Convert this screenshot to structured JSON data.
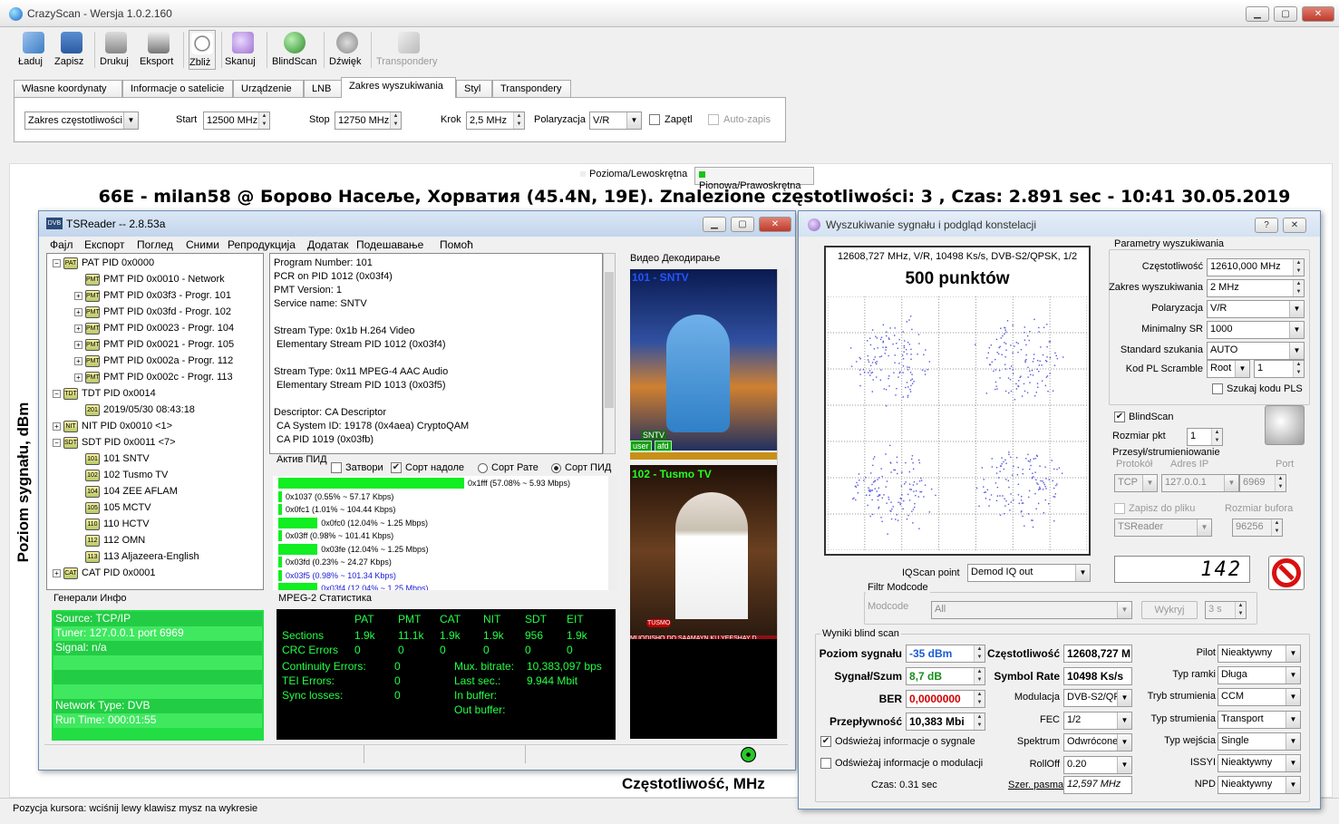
{
  "app": {
    "title": "CrazyScan - Wersja 1.0.2.160"
  },
  "toolbar": [
    {
      "label": "Ładuj",
      "icon": "folder-open-icon"
    },
    {
      "label": "Zapisz",
      "icon": "save-icon"
    },
    {
      "label": "Drukuj",
      "icon": "printer-icon"
    },
    {
      "label": "Eksport",
      "icon": "export-icon"
    },
    {
      "label": "Zbliż",
      "icon": "zoom-icon"
    },
    {
      "label": "Skanuj",
      "icon": "magnifier-icon"
    },
    {
      "label": "BlindScan",
      "icon": "globe-icon"
    },
    {
      "label": "Dźwięk",
      "icon": "speaker-icon"
    },
    {
      "label": "Transpondery",
      "icon": "transponders-icon"
    }
  ],
  "tabs": [
    "Własne koordynaty",
    "Informacje o satelicie",
    "Urządzenie",
    "LNB",
    "Zakres wyszukiwania",
    "Styl",
    "Transpondery"
  ],
  "range": {
    "mode": "Zakres częstotliwości",
    "start_label": "Start",
    "start": "12500 MHz",
    "stop_label": "Stop",
    "stop": "12750 MHz",
    "step_label": "Krok",
    "step": "2,5 MHz",
    "pol_label": "Polaryzacja",
    "pol": "V/R",
    "loop": "Zapętl",
    "autosave": "Auto-zapis"
  },
  "chart": {
    "legend_h": "Pozioma/Lewoskrętna",
    "legend_v": "Pionowa/Prawoskrętna",
    "headline": "66E - milan58 @ Борово Насеље, Хорватия (45.4N, 19E). Znalezione częstotliwości: 3 , Czas: 2.891 sec - 10:41 30.05.2019",
    "ylabel": "Poziom sygnału, dBm",
    "xlabel": "Częstotliwość, MHz"
  },
  "status": "Pozycja kursora: wciśnij lewy klawisz mysz na wykresie",
  "ts": {
    "title": "TSReader -- 2.8.53a",
    "menu": [
      "Фајл",
      "Експорт",
      "Поглед",
      "Сними",
      "Репродукција",
      "Додатак",
      "Подешавање",
      "Помоћ"
    ],
    "tree": [
      {
        "t": "PAT PID 0x0000",
        "lvl": 0,
        "exp": "−"
      },
      {
        "t": "PMT PID 0x0010 - Network",
        "lvl": 1,
        "exp": ""
      },
      {
        "t": "PMT PID 0x03f3 - Progr. 101",
        "lvl": 1,
        "exp": "+"
      },
      {
        "t": "PMT PID 0x03fd - Progr. 102",
        "lvl": 1,
        "exp": "+"
      },
      {
        "t": "PMT PID 0x0023 - Progr. 104",
        "lvl": 1,
        "exp": "+"
      },
      {
        "t": "PMT PID 0x0021 - Progr. 105",
        "lvl": 1,
        "exp": "+"
      },
      {
        "t": "PMT PID 0x002a - Progr. 112",
        "lvl": 1,
        "exp": "+"
      },
      {
        "t": "PMT PID 0x002c - Progr. 113",
        "lvl": 1,
        "exp": "+"
      },
      {
        "t": "TDT PID 0x0014",
        "lvl": 0,
        "exp": "−"
      },
      {
        "t": "2019/05/30 08:43:18",
        "lvl": 1,
        "exp": ""
      },
      {
        "t": "NIT PID 0x0010 <1>",
        "lvl": 0,
        "exp": "+"
      },
      {
        "t": "SDT PID 0x0011 <7>",
        "lvl": 0,
        "exp": "−"
      },
      {
        "t": "101 SNTV",
        "lvl": 1,
        "exp": ""
      },
      {
        "t": "102 Tusmo TV",
        "lvl": 1,
        "exp": ""
      },
      {
        "t": "104 ZEE AFLAM",
        "lvl": 1,
        "exp": ""
      },
      {
        "t": "105 MCTV",
        "lvl": 1,
        "exp": ""
      },
      {
        "t": "110 HCTV",
        "lvl": 1,
        "exp": ""
      },
      {
        "t": "112 OMN",
        "lvl": 1,
        "exp": ""
      },
      {
        "t": "113 Aljazeera-English",
        "lvl": 1,
        "exp": ""
      },
      {
        "t": "CAT PID 0x0001",
        "lvl": 0,
        "exp": "+"
      }
    ],
    "info": [
      "Program Number: 101",
      "PCR on PID 1012 (0x03f4)",
      "PMT Version: 1",
      "Service name: SNTV",
      "",
      "Stream Type: 0x1b H.264 Video",
      " Elementary Stream PID 1012 (0x03f4)",
      "",
      "Stream Type: 0x11 MPEG-4 AAC Audio",
      " Elementary Stream PID 1013 (0x03f5)",
      "",
      "Descriptor: CA Descriptor",
      " CA System ID: 19178 (0x4aea) CryptoQAM",
      " CA PID 1019 (0x03fb)"
    ],
    "active_pid": "Актив ПИД",
    "opts": [
      "Затвори",
      "Сорт надоле",
      "Сорт Рате",
      "Сорт ПИД"
    ],
    "bars": [
      {
        "l": "0x1fff (57.08% ~ 5.93 Mbps)",
        "v": 57.08
      },
      {
        "l": "0x1037 (0.55% ~ 57.17 Kbps)",
        "v": 0.55
      },
      {
        "l": "0x0fc1 (1.01% ~ 104.44 Kbps)",
        "v": 1.01
      },
      {
        "l": "0x0fc0 (12.04% ~ 1.25 Mbps)",
        "v": 12.04
      },
      {
        "l": "0x03ff (0.98% ~ 101.41 Kbps)",
        "v": 0.98
      },
      {
        "l": "0x03fe (12.04% ~ 1.25 Mbps)",
        "v": 12.04
      },
      {
        "l": "0x03fd (0.23% ~ 24.27 Kbps)",
        "v": 0.23
      },
      {
        "l": "0x03f5 (0.98% ~ 101.34 Kbps)",
        "v": 0.98
      },
      {
        "l": "0x03f4 (12.04% ~ 1.25 Mbps)",
        "v": 12.04
      }
    ],
    "video_label": "Видео Декодирање",
    "ch1": "101 - SNTV",
    "ch2": "102 - Tusmo TV",
    "ch1_logo": "SNTV",
    "ch1_tags": [
      "user",
      "afd"
    ],
    "ch2_ticker": "MUQDISHO DO SAAMAYN KU YEESHAY D",
    "ch2_logo": "TUSMO",
    "general": "Генерали Инфо",
    "gen_lines": [
      "Source: TCP/IP",
      "Tuner: 127.0.0.1 port 6969",
      "Signal: n/a",
      "",
      "",
      "",
      "Network Type: DVB",
      "Run Time: 000:01:55"
    ],
    "mpeg": "MPEG-2 Статистика",
    "stat_head": [
      "PAT",
      "PMT",
      "CAT",
      "NIT",
      "SDT",
      "EIT"
    ],
    "stat_rows": [
      {
        "n": "Sections",
        "v": [
          "1.9k",
          "11.1k",
          "1.9k",
          "1.9k",
          "956",
          "1.9k"
        ]
      },
      {
        "n": "CRC Errors",
        "v": [
          "0",
          "0",
          "0",
          "0",
          "0",
          "0"
        ]
      }
    ],
    "stat_lines": [
      {
        "n": "Continuity Errors:",
        "v": "0",
        "k": "Mux. bitrate:",
        "w": "10,383,097 bps"
      },
      {
        "n": "TEI Errors:",
        "v": "0",
        "k": "Last sec.:",
        "w": "9.944 Mbit"
      },
      {
        "n": "Sync losses:",
        "v": "0",
        "k": "In buffer:",
        "w": ""
      },
      {
        "n": "",
        "v": "",
        "k": "Out buffer:",
        "w": ""
      }
    ]
  },
  "scan": {
    "title": "Wyszukiwanie sygnału i podgląd konstelacji",
    "const_info": "12608,727 MHz, V/R, 10498 Ks/s, DVB-S2/QPSK, 1/2",
    "points": "500 punktów",
    "params_title": "Parametry wyszukiwania",
    "params": [
      {
        "l": "Częstotliwość",
        "v": "12610,000 MHz"
      },
      {
        "l": "Zakres wyszukiwania",
        "v": "2 MHz"
      },
      {
        "l": "Polaryzacja",
        "v": "V/R"
      },
      {
        "l": "Minimalny SR",
        "v": "1000"
      },
      {
        "l": "Standard szukania",
        "v": "AUTO"
      }
    ],
    "pl_label": "Kod PL Scramble",
    "pl_mode": "Root",
    "pl_val": "1",
    "pls_search": "Szukaj kodu PLS",
    "blindscan": "BlindScan",
    "pkt_label": "Rozmiar pkt",
    "pkt": "1",
    "stream_title": "Przesył/strumieniowanie",
    "proto_l": "Protokół",
    "ip_l": "Adres IP",
    "port_l": "Port",
    "proto": "TCP",
    "ip": "127.0.0.1",
    "port": "6969",
    "save_file": "Zapisz do pliku",
    "buf_l": "Rozmiar bufora",
    "target": "TSReader",
    "buf": "96256",
    "iq_label": "IQScan point",
    "iq": "Demod IQ out",
    "counter": "142",
    "filter_title": "Filtr Modcode",
    "modcode_l": "Modcode",
    "modcode": "All",
    "exclude": "Wykryj",
    "exclude_t": "3 s",
    "results_title": "Wyniki blind scan",
    "res_left": [
      {
        "l": "Poziom sygnału",
        "v": "-35 dBm",
        "c": "#1a5bd6"
      },
      {
        "l": "Sygnał/Szum",
        "v": "8,7 dB",
        "c": "#1a8c1a"
      },
      {
        "l": "BER",
        "v": "0,0000000",
        "c": "#d00000"
      },
      {
        "l": "Przepływność",
        "v": "10,383 Mbi",
        "c": "#000000"
      }
    ],
    "res_mid": [
      {
        "l": "Częstotliwość",
        "v": "12608,727 M",
        "bold": true
      },
      {
        "l": "Symbol Rate",
        "v": "10498 Ks/s",
        "bold": true
      },
      {
        "l": "Modulacja",
        "v": "DVB-S2/QPSK",
        "bold": false
      },
      {
        "l": "FEC",
        "v": "1/2",
        "bold": false
      },
      {
        "l": "Spektrum",
        "v": "Odwrócone",
        "bold": false
      },
      {
        "l": "RollOff",
        "v": "0.20",
        "bold": false
      }
    ],
    "res_right": [
      {
        "l": "Pilot",
        "v": "Nieaktywny"
      },
      {
        "l": "Typ ramki",
        "v": "Długa"
      },
      {
        "l": "Tryb strumienia",
        "v": "CCM"
      },
      {
        "l": "Typ strumienia",
        "v": "Transport"
      },
      {
        "l": "Typ wejścia",
        "v": "Single"
      },
      {
        "l": "ISSYI",
        "v": "Nieaktywny"
      },
      {
        "l": "NPD",
        "v": "Nieaktywny"
      }
    ],
    "refresh_sig": "Odświeżaj informacje o sygnale",
    "refresh_mod": "Odświeżaj informacje o modulacji",
    "time": "Czas: 0.31 sec",
    "bw_l": "Szer. pasma",
    "bw": "12,597 MHz"
  }
}
